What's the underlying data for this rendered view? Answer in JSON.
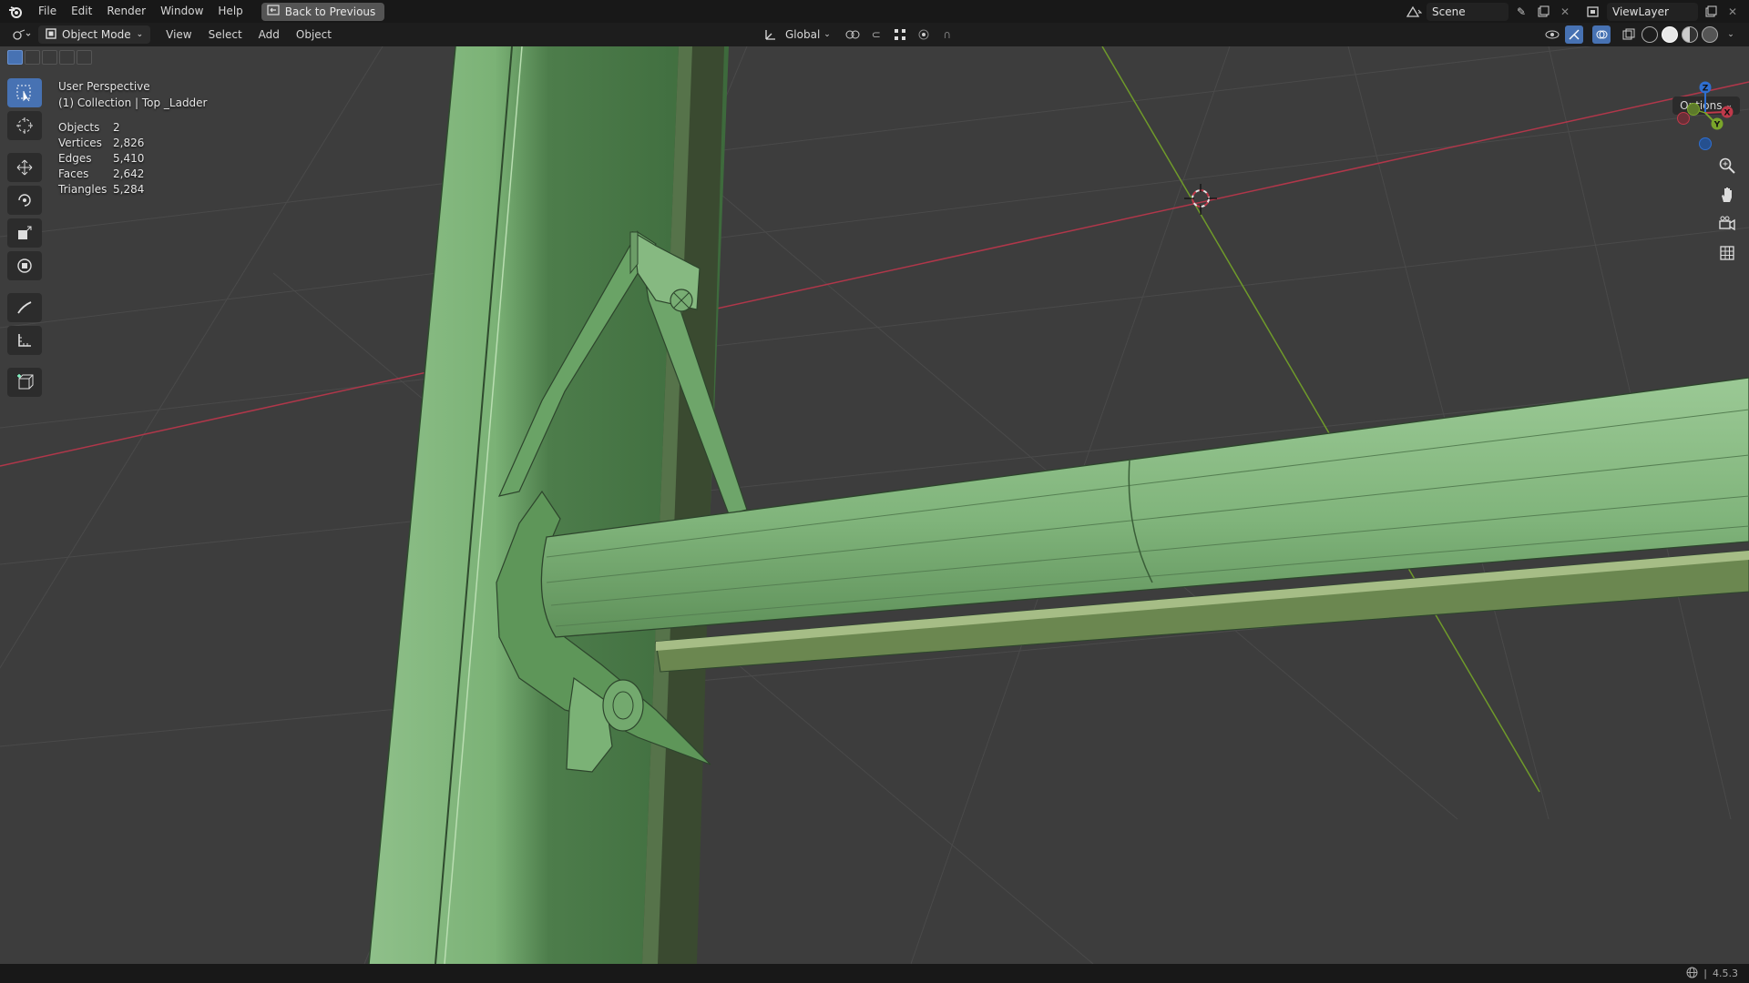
{
  "menu": {
    "items": [
      "File",
      "Edit",
      "Render",
      "Window",
      "Help"
    ],
    "back_button": "Back to Previous"
  },
  "top_right": {
    "scene": "Scene",
    "view_layer": "ViewLayer"
  },
  "viewport_header": {
    "mode": "Object Mode",
    "menus": [
      "View",
      "Select",
      "Add",
      "Object"
    ],
    "transform_orientation": "Global"
  },
  "overlay": {
    "perspective": "User Perspective",
    "collection": "(1) Collection | Top _Ladder",
    "stats": [
      {
        "label": "Objects",
        "value": "2"
      },
      {
        "label": "Vertices",
        "value": "2,826"
      },
      {
        "label": "Edges",
        "value": "5,410"
      },
      {
        "label": "Faces",
        "value": "2,642"
      },
      {
        "label": "Triangles",
        "value": "5,284"
      }
    ]
  },
  "options_label": "Options",
  "gizmo": {
    "x": "X",
    "y": "Y",
    "z": "Z"
  },
  "status": {
    "version": "4.5.3"
  },
  "colors": {
    "model_green": "#7fb07a",
    "x_axis": "#c0394a",
    "y_axis": "#7aa52a",
    "z_axis": "#2f6fd1",
    "active_blue": "#4772b3"
  },
  "icons": [
    "blender-logo-icon",
    "select-box-icon",
    "cursor-icon",
    "move-icon",
    "rotate-icon",
    "scale-icon",
    "transform-icon",
    "annotate-icon",
    "measure-icon",
    "add-cube-icon",
    "zoom-icon",
    "hand-icon",
    "camera-icon",
    "grid-icon"
  ]
}
